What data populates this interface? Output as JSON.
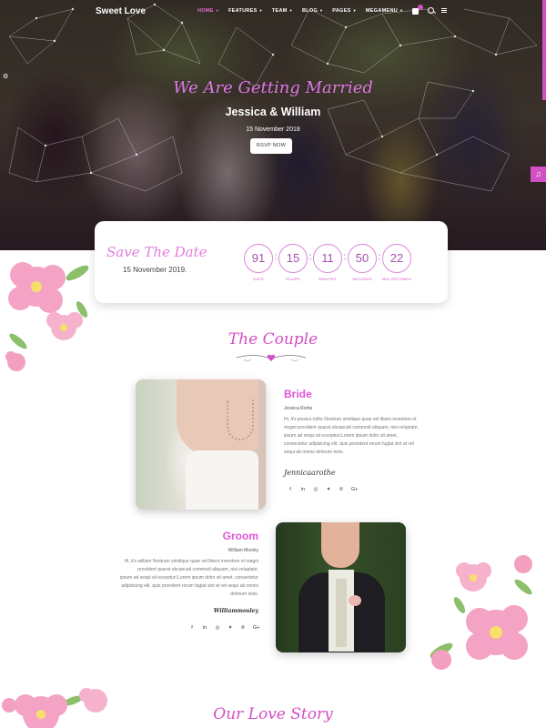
{
  "nav": {
    "logo": "Sweet Love",
    "items": [
      {
        "label": "HOME",
        "active": true
      },
      {
        "label": "FEATURES",
        "active": false
      },
      {
        "label": "TEAM",
        "active": false
      },
      {
        "label": "BLOG",
        "active": false
      },
      {
        "label": "PAGES",
        "active": false
      },
      {
        "label": "MEGAMENU",
        "active": false
      }
    ],
    "icons": [
      "cart-icon",
      "search-icon",
      "menu-icon"
    ]
  },
  "hero": {
    "script": "We Are Getting Married",
    "names": "Jessica & William",
    "date": "15 November 2018",
    "button": "RSVP NOW",
    "music_icon": "♫",
    "side_icon": "gear-icon"
  },
  "save_the_date": {
    "script": "Save The Date",
    "date": "15 November 2019.",
    "countdown": [
      {
        "value": "91",
        "label": "DAYS"
      },
      {
        "value": "15",
        "label": "HOURS"
      },
      {
        "value": "11",
        "label": "MINUTES"
      },
      {
        "value": "50",
        "label": "SECONDS"
      },
      {
        "value": "22",
        "label": "MILLISECONDS"
      }
    ]
  },
  "couple": {
    "title": "The Couple",
    "bride": {
      "title": "Bride",
      "name": "Jessica Rothe",
      "text": [
        "Hi, it's jessica rothe Nostrum similique quae vel libero inventore et",
        "magni provident quarat obcaecati commodi aliquam, nisi voluptate,",
        "ipsum ad sequi sit excepturi.Lorem ipsum dolor sit amet,",
        "consectetur adipisicing elit. quis provident rerum fugiat sint at vel",
        "sequi ab omnis dolorum nisis."
      ],
      "signature": "Jennicaarothe"
    },
    "groom": {
      "title": "Groom",
      "name": "William Mosley",
      "text": [
        "Hi, it's william Nostrum similique quae vel libero inventore et magni",
        "provident quarat obcaecati commodi aliquam, nisi voluptate,",
        "ipsum ad sequi sit excepturi.Lorem ipsum dolor sit amet, consectetur",
        "adipisicing elit. quis provident rerum fugiat sint at vel sequi ab omnis",
        "dolorum nisis."
      ],
      "signature": "Williammosley"
    },
    "socials": [
      "f",
      "in",
      "◎",
      "✦",
      "℗",
      "G+"
    ]
  },
  "story": {
    "title": "Our Love Story"
  },
  "colors": {
    "accent": "#d24fc4",
    "script": "#e47be2",
    "countdown_ring": "#d989d9"
  }
}
